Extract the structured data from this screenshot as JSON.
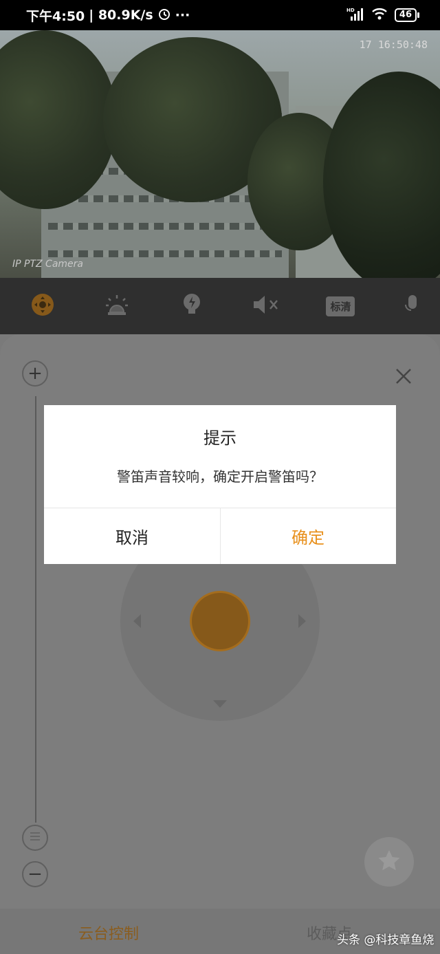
{
  "status_bar": {
    "time": "下午4:50",
    "speed": "| 80.9K/s",
    "more": "···",
    "network": "HD",
    "battery": "46"
  },
  "camera": {
    "timestamp": "17 16:50:48",
    "label": "IP PTZ Camera"
  },
  "toolbar": {
    "quality_label": "标清",
    "items": [
      "ptz-control",
      "siren",
      "light",
      "mute",
      "quality",
      "microphone"
    ]
  },
  "dialog": {
    "title": "提示",
    "message": "警笛声音较响，确定开启警笛吗？",
    "cancel_label": "取消",
    "confirm_label": "确定"
  },
  "panel": {
    "zoom_in": "+",
    "zoom_out": "−"
  },
  "tabs": {
    "ptz": "云台控制",
    "favorites": "收藏点"
  },
  "watermark": "头条 @科技章鱼烧",
  "colors": {
    "accent": "#e8901c",
    "dim_accent": "#86591a"
  }
}
